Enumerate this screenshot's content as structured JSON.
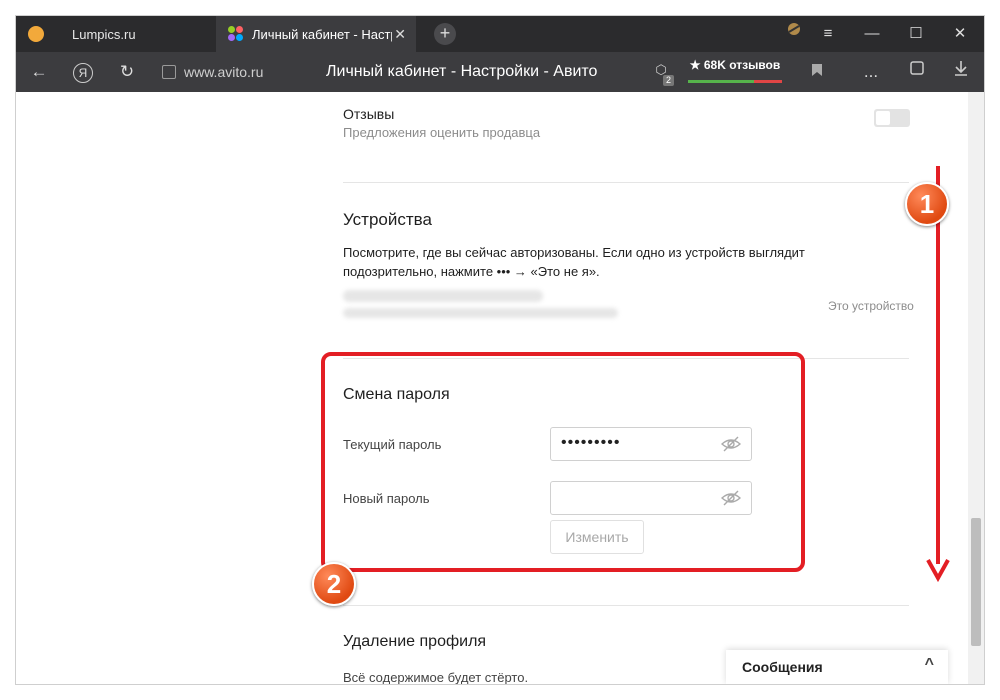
{
  "browser": {
    "tabs": [
      {
        "title": "Lumpics.ru"
      },
      {
        "title": "Личный кабинет - Настр",
        "close": "✕"
      }
    ],
    "new_tab": "+",
    "window_controls": {
      "menu": "≡",
      "minimize": "—",
      "maximize": "☐",
      "close": "✕"
    },
    "nav": {
      "back": "←",
      "ya": "Я",
      "reload": "↻",
      "url": "www.avito.ru",
      "more": "..."
    },
    "page_title": "Личный кабинет - Настройки - Авито",
    "badge_count": "2",
    "reviews": "★ 68K отзывов"
  },
  "settings": {
    "reviews_section": {
      "title": "Отзывы",
      "subtitle": "Предложения оценить продавца",
      "toggle_on": false
    },
    "devices": {
      "title": "Устройства",
      "description_line1": "Посмотрите, где вы сейчас авторизованы. Если одно из устройств выглядит",
      "description_line2": "подозрительно, нажмите ••• → «Это не я».",
      "this_device": "Это устройство"
    },
    "password": {
      "title": "Смена пароля",
      "current_label": "Текущий пароль",
      "current_value": "•••••••••",
      "new_label": "Новый пароль",
      "new_value": "",
      "submit": "Изменить"
    },
    "delete_profile": {
      "title": "Удаление профиля",
      "description": "Всё содержимое будет стёрто."
    }
  },
  "messages_widget": {
    "label": "Сообщения",
    "chevron": "^"
  },
  "annotations": {
    "step1": "1",
    "step2": "2",
    "color": "#e31e24"
  }
}
